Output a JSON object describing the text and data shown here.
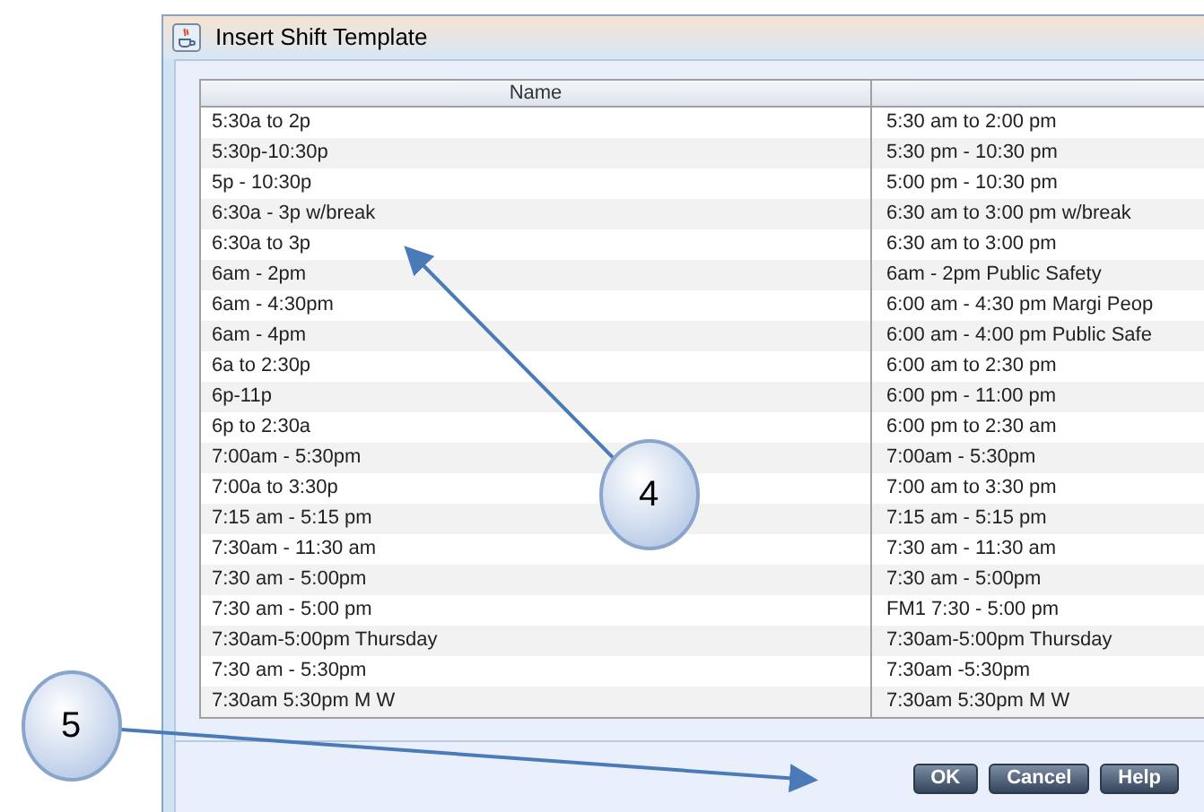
{
  "window": {
    "title": "Insert Shift Template"
  },
  "table": {
    "columns": [
      "Name"
    ],
    "rows": [
      {
        "name": "5:30a to 2p",
        "column_2": "5:30 am to 2:00 pm"
      },
      {
        "name": "5:30p-10:30p",
        "column_2": "5:30 pm - 10:30 pm"
      },
      {
        "name": "5p - 10:30p",
        "column_2": "5:00 pm - 10:30 pm"
      },
      {
        "name": "6:30a - 3p w/break",
        "column_2": "6:30 am to 3:00 pm w/break"
      },
      {
        "name": "6:30a to 3p",
        "column_2": "6:30 am to 3:00 pm"
      },
      {
        "name": "6am - 2pm",
        "column_2": "6am - 2pm Public Safety"
      },
      {
        "name": "6am - 4:30pm",
        "column_2": "6:00 am - 4:30 pm Margi Peop"
      },
      {
        "name": "6am - 4pm",
        "column_2": "6:00 am - 4:00 pm Public Safe"
      },
      {
        "name": "6a to 2:30p",
        "column_2": "6:00 am to 2:30 pm"
      },
      {
        "name": "6p-11p",
        "column_2": "6:00 pm - 11:00 pm"
      },
      {
        "name": "6p to 2:30a",
        "column_2": "6:00 pm to 2:30 am"
      },
      {
        "name": "7:00am - 5:30pm",
        "column_2": "7:00am - 5:30pm"
      },
      {
        "name": "7:00a to 3:30p",
        "column_2": "7:00 am to 3:30 pm"
      },
      {
        "name": "7:15 am - 5:15 pm",
        "column_2": "7:15 am - 5:15 pm"
      },
      {
        "name": "7:30am - 11:30 am",
        "column_2": "7:30 am - 11:30 am"
      },
      {
        "name": "7:30 am - 5:00pm",
        "column_2": "7:30 am - 5:00pm"
      },
      {
        "name": "7:30 am - 5:00 pm",
        "column_2": "FM1 7:30 - 5:00 pm"
      },
      {
        "name": "7:30am-5:00pm Thursday",
        "column_2": "7:30am-5:00pm Thursday"
      },
      {
        "name": "7:30 am - 5:30pm",
        "column_2": "7:30am -5:30pm"
      },
      {
        "name": "7:30am 5:30pm M W",
        "column_2": "7:30am 5:30pm M W"
      }
    ]
  },
  "buttons": [
    "OK",
    "Cancel",
    "Help"
  ],
  "callouts": [
    {
      "label": "4"
    },
    {
      "label": "5"
    }
  ]
}
